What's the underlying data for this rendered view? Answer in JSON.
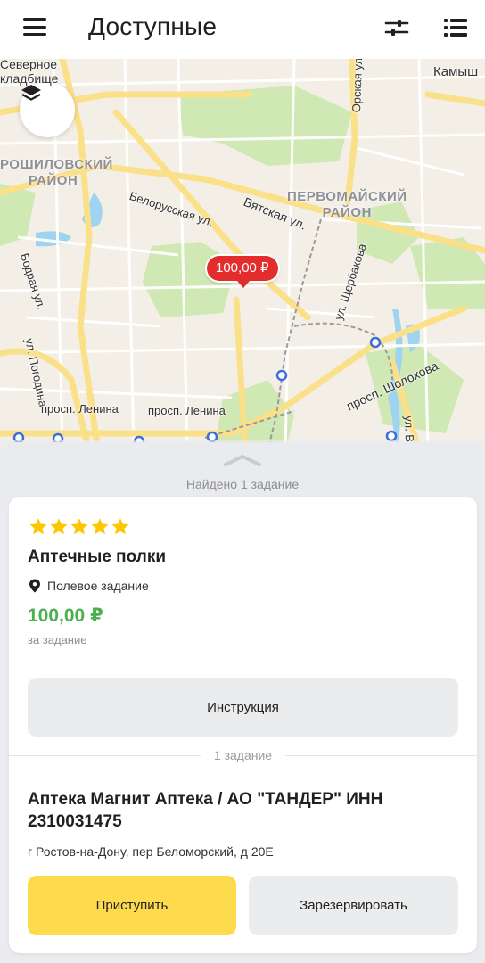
{
  "header": {
    "title": "Доступные",
    "menu_icon": "hamburger-menu-icon",
    "filter_icon": "sliders-icon",
    "list_icon": "list-icon"
  },
  "map": {
    "layers_icon": "layers-icon",
    "price_pin": "100,00 ₽",
    "street_labels": {
      "severnoe": "Северное",
      "kladbische": "кладбище",
      "kamysh": "Камыш",
      "orskaya": "Орская ул.",
      "belorusskaya": "Белорусская ул.",
      "vyatskaya": "Вятская ул.",
      "bodraya": "Бодрая ул.",
      "scherbakova": "ул. Щербакова",
      "pogodina": "ул. Погодина",
      "sholohova": "просп. Шолохова",
      "lenina_1": "просп. Ленина",
      "lenina_2": "просп. Ленина",
      "ve": "ул. Ве"
    },
    "district_labels": {
      "voroshilovsky_1": "РОШИЛОВСКИЙ",
      "voroshilovsky_2": "РАЙОН",
      "pervomaysky_1": "ПЕРВОМАЙСКИЙ",
      "pervomaysky_2": "РАЙОН"
    }
  },
  "sheet": {
    "found_text": "Найдено 1 задание",
    "card": {
      "rating": 5,
      "title": "Аптечные полки",
      "location_icon": "map-pin-icon",
      "task_type": "Полевое задание",
      "price": "100,00 ₽",
      "price_note": "за задание",
      "instruction_button": "Инструкция",
      "divider_text": "1 задание",
      "place_name": "Аптека Магнит Аптека / АО \"ТАНДЕР\" ИНН 2310031475",
      "address": "г Ростов-на-Дону, пер Беломорский, д 20Е",
      "start_button": "Приступить",
      "reserve_button": "Зарезервировать"
    }
  },
  "colors": {
    "accent_yellow": "#fddb4d",
    "price_green": "#4caf50",
    "pin_red": "#e32c2c",
    "star_yellow": "#fcc701"
  }
}
